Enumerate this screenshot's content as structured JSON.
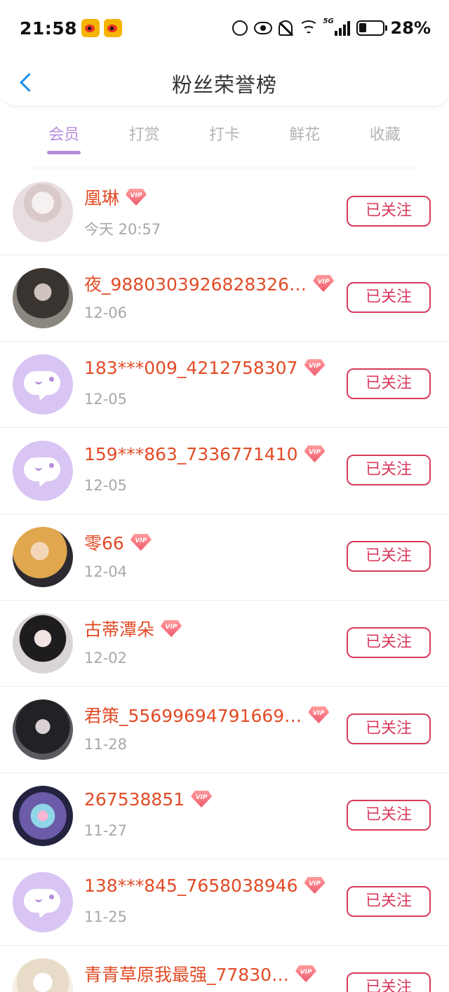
{
  "status_bar": {
    "time": "21:58",
    "battery_percent": "28%",
    "icons": [
      "weibo-icon",
      "weibo-icon",
      "data-saver-icon",
      "eye-icon",
      "bell-off-icon",
      "wifi-icon",
      "5g-signal-icon",
      "battery-icon"
    ]
  },
  "header": {
    "title": "粉丝荣誉榜",
    "back_icon": "chevron-left-icon"
  },
  "tabs": [
    {
      "label": "会员",
      "active": true
    },
    {
      "label": "打赏",
      "active": false
    },
    {
      "label": "打卡",
      "active": false
    },
    {
      "label": "鲜花",
      "active": false
    },
    {
      "label": "收藏",
      "active": false
    }
  ],
  "vip_label": "VIP",
  "follow_label": "已关注",
  "users": [
    {
      "name": "凰琳",
      "date": "今天 20:57",
      "avatar": "photo"
    },
    {
      "name": "夜_9880303926828326…",
      "date": "12-06",
      "avatar": "photo"
    },
    {
      "name": "183***009_4212758307",
      "date": "12-05",
      "avatar": "default"
    },
    {
      "name": "159***863_7336771410",
      "date": "12-05",
      "avatar": "default"
    },
    {
      "name": "零66",
      "date": "12-04",
      "avatar": "photo"
    },
    {
      "name": "古蒂潭朵",
      "date": "12-02",
      "avatar": "photo"
    },
    {
      "name": "君策_55699694791669…",
      "date": "11-28",
      "avatar": "photo"
    },
    {
      "name": "267538851",
      "date": "11-27",
      "avatar": "photo"
    },
    {
      "name": "138***845_7658038946",
      "date": "11-25",
      "avatar": "default"
    },
    {
      "name": "青青草原我最强_77830…",
      "date": "",
      "avatar": "photo"
    }
  ],
  "colors": {
    "accent_purple": "#b48cda",
    "name_red": "#e24b26",
    "follow_border": "#d83a5c",
    "back_blue": "#1a8ff0"
  }
}
